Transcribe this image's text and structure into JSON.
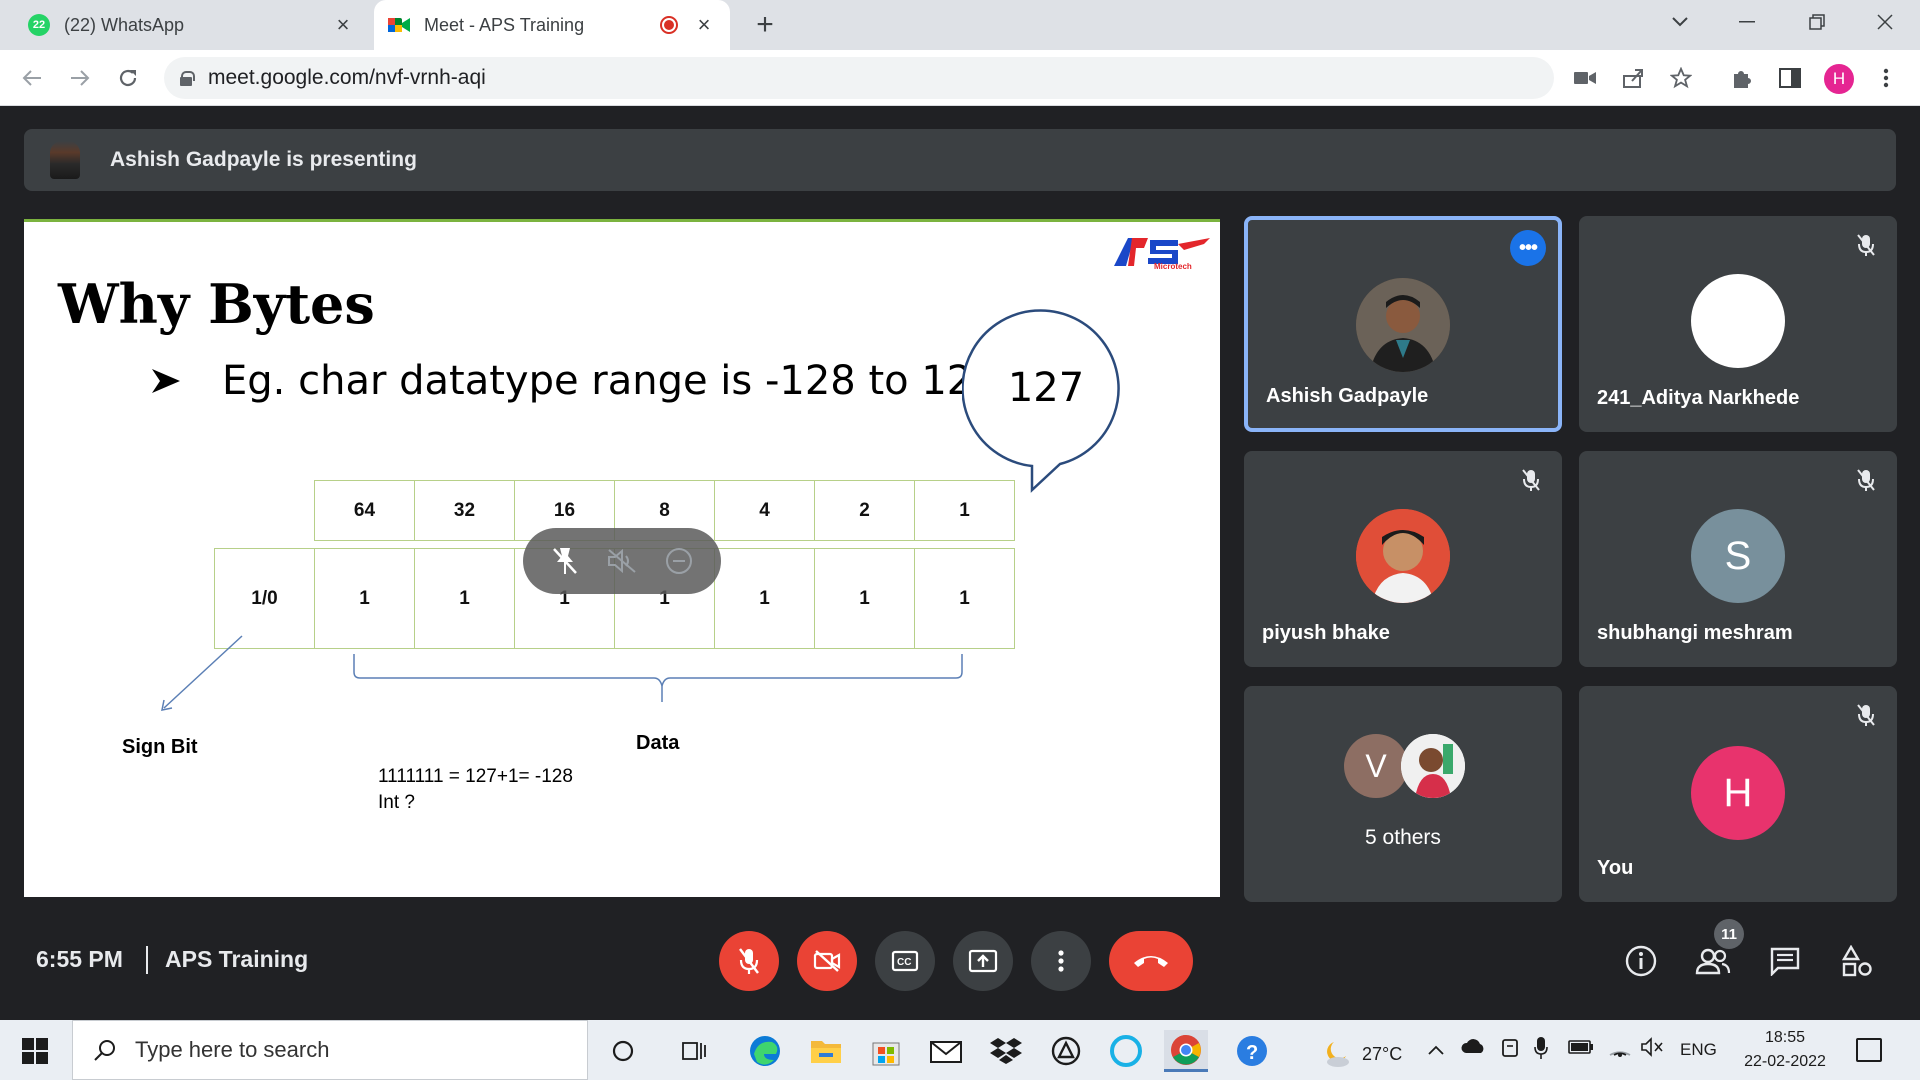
{
  "browser": {
    "tabs": [
      {
        "label": "(22) WhatsApp",
        "badge": "22",
        "active": false
      },
      {
        "label": "Meet - APS Training",
        "active": true
      }
    ],
    "url": "meet.google.com/nvf-vrnh-aqi",
    "profile_initial": "H"
  },
  "banner": {
    "text": "Ashish Gadpayle is presenting"
  },
  "slide": {
    "title": "Why Bytes",
    "bullet": "Eg. char datatype range is -128 to 127",
    "callout_value": "127",
    "logo_text": "Microtech",
    "header_row": [
      "64",
      "32",
      "16",
      "8",
      "4",
      "2",
      "1"
    ],
    "data_row": [
      "1/0",
      "1",
      "1",
      "1",
      "1",
      "1",
      "1",
      "1"
    ],
    "sign_label": "Sign Bit",
    "data_label": "Data",
    "equation": "1111111 = 127+1= -128",
    "question": "Int ?"
  },
  "participants": [
    {
      "name": "Ashish Gadpayle",
      "speaking": true
    },
    {
      "name": "241_Aditya Narkhede",
      "muted": true
    },
    {
      "name": "piyush bhake",
      "muted": true
    },
    {
      "name": "shubhangi meshram",
      "muted": true,
      "initial": "S",
      "color": "#78909c"
    },
    {
      "name": "5 others",
      "initials": [
        "V"
      ]
    },
    {
      "name": "You",
      "muted": true,
      "initial": "H",
      "color": "#e8336d"
    }
  ],
  "meeting": {
    "time": "6:55 PM",
    "name": "APS Training",
    "people_count": "11"
  },
  "taskbar": {
    "search_placeholder": "Type here to search",
    "temperature": "27°C",
    "language": "ENG",
    "time": "18:55",
    "date": "22-02-2022"
  },
  "colors": {
    "meet_bg": "#202124",
    "tile_bg": "#3c4043",
    "danger": "#ea4335",
    "accent": "#1a73e8"
  }
}
